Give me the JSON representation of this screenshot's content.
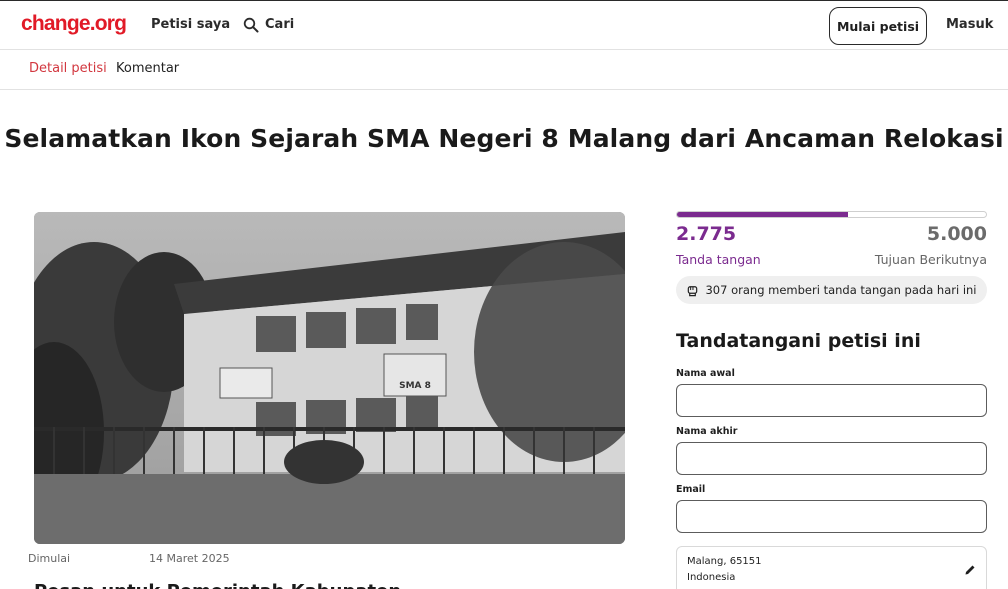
{
  "header": {
    "logo": "change.org",
    "nav_my_petitions": "Petisi saya",
    "nav_search": "Cari",
    "start_button": "Mulai petisi",
    "login": "Masuk",
    "brand_color": "#e11a27"
  },
  "subnav": {
    "tabs": [
      {
        "label": "Detail petisi",
        "active": true
      },
      {
        "label": "Komentar",
        "active": false
      }
    ]
  },
  "petition": {
    "title": "Selamatkan Ikon Sejarah SMA Negeri 8 Malang dari Ancaman Relokasi",
    "photo_sign_text": "SMA 8",
    "started_label": "Dimulai",
    "started_date": "14 Maret 2025",
    "cut_off_heading": "Pesan untuk Pemerintah Kabupaten"
  },
  "progress": {
    "signatures": "2.775",
    "signatures_label": "Tanda tangan",
    "goal": "5.000",
    "goal_label": "Tujuan Berikutnya",
    "fraction": 0.555,
    "today_text": "307 orang memberi tanda tangan pada hari ini",
    "accent_color": "#7b2b8f"
  },
  "sign_form": {
    "title": "Tandatangani petisi ini",
    "first_name_label": "Nama awal",
    "last_name_label": "Nama akhir",
    "email_label": "Email",
    "location_line1": "Malang, 65151",
    "location_line2": "Indonesia"
  },
  "icons": [
    "search-icon",
    "fist-icon",
    "pencil-icon"
  ]
}
